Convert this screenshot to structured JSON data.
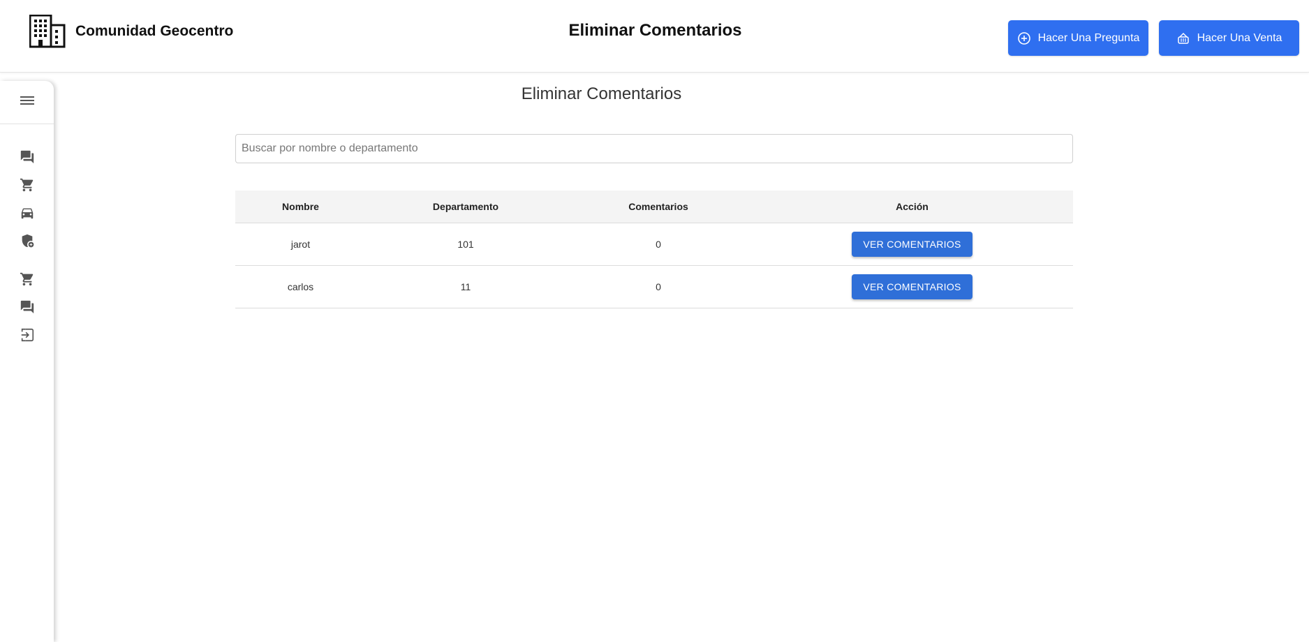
{
  "header": {
    "brand_name": "Comunidad Geocentro",
    "brand_icon": "building-icon",
    "title": "Eliminar Comentarios",
    "buttons": [
      {
        "label": "Hacer Una Pregunta",
        "icon": "add-circle-icon"
      },
      {
        "label": "Hacer Una Venta",
        "icon": "basket-icon"
      }
    ],
    "accent_color": "#2f6ff0"
  },
  "sidebar": {
    "toggle_icon": "hamburger-menu-icon",
    "items": [
      {
        "icon": "forum-icon"
      },
      {
        "icon": "cart-icon"
      },
      {
        "icon": "car-icon"
      },
      {
        "icon": "shield-icon"
      },
      {
        "icon": "cart-icon"
      },
      {
        "icon": "forum-icon"
      },
      {
        "icon": "logout-icon"
      }
    ]
  },
  "main": {
    "title": "Eliminar Comentarios",
    "search": {
      "placeholder": "Buscar por nombre o departamento",
      "value": ""
    },
    "table": {
      "columns": [
        "Nombre",
        "Departamento",
        "Comentarios",
        "Acción"
      ],
      "rows": [
        {
          "nombre": "jarot",
          "departamento": "101",
          "comentarios": "0",
          "accion": "VER COMENTARIOS"
        },
        {
          "nombre": "carlos",
          "departamento": "11",
          "comentarios": "0",
          "accion": "VER COMENTARIOS"
        }
      ]
    },
    "button_color": "#2f6fd8"
  }
}
